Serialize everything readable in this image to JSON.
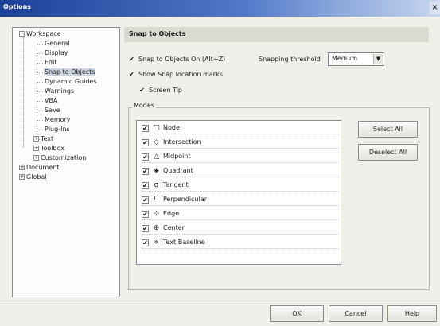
{
  "window": {
    "title": "Options",
    "close_glyph": "×"
  },
  "tree": {
    "items": [
      {
        "label": "Workspace",
        "expander": "−"
      },
      {
        "label": "General"
      },
      {
        "label": "Display"
      },
      {
        "label": "Edit"
      },
      {
        "label": "Snap to Objects",
        "selected": true
      },
      {
        "label": "Dynamic Guides"
      },
      {
        "label": "Warnings"
      },
      {
        "label": "VBA"
      },
      {
        "label": "Save"
      },
      {
        "label": "Memory"
      },
      {
        "label": "Plug-Ins"
      },
      {
        "label": "Text",
        "expander": "+"
      },
      {
        "label": "Toolbox",
        "expander": "+"
      },
      {
        "label": "Customization",
        "expander": "+"
      },
      {
        "label": "Document",
        "expander": "+"
      },
      {
        "label": "Global",
        "expander": "+"
      }
    ]
  },
  "panel": {
    "header": "Snap to Objects",
    "snap_on_label": "Snap to Objects On (Alt+Z)",
    "snapping_threshold_label": "Snapping threshold",
    "snapping_threshold_value": "Medium",
    "dropdown_arrow": "▼",
    "show_marks_label": "Show Snap location marks",
    "screen_tip_label": "Screen Tip",
    "check_glyph": "✔",
    "modes_group_label": "Modes",
    "modes": [
      {
        "label": "Node",
        "icon": "□",
        "icon_name": "node-icon"
      },
      {
        "label": "Intersection",
        "icon": "◇",
        "icon_name": "intersection-icon"
      },
      {
        "label": "Midpoint",
        "icon": "△",
        "icon_name": "midpoint-icon"
      },
      {
        "label": "Quadrant",
        "icon": "◈",
        "icon_name": "quadrant-icon"
      },
      {
        "label": "Tangent",
        "icon": "σ",
        "icon_name": "tangent-icon"
      },
      {
        "label": "Perpendicular",
        "icon": "∟",
        "icon_name": "perpendicular-icon"
      },
      {
        "label": "Edge",
        "icon": "⊹",
        "icon_name": "edge-icon"
      },
      {
        "label": "Center",
        "icon": "⊕",
        "icon_name": "center-icon"
      },
      {
        "label": "Text Baseline",
        "icon": "⋄",
        "icon_name": "text-baseline-icon"
      }
    ],
    "mode_check_glyph": "☑",
    "select_all_label": "Select All",
    "deselect_all_label": "Deselect All"
  },
  "footer": {
    "ok_label": "OK",
    "cancel_label": "Cancel",
    "help_label": "Help"
  }
}
